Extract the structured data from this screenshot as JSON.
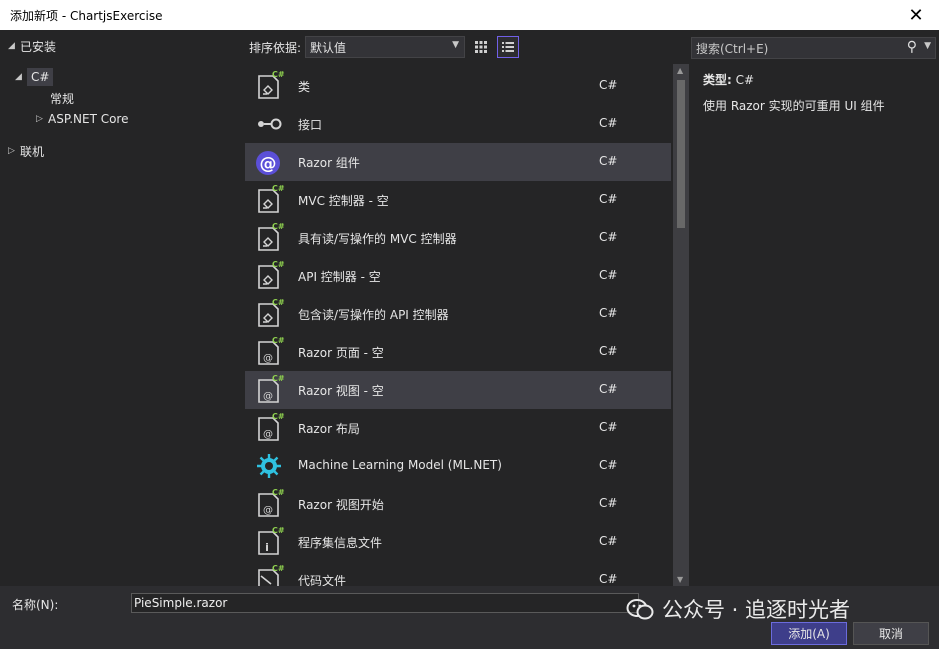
{
  "window": {
    "title": "添加新项 - ChartjsExercise",
    "close_glyph": "✕"
  },
  "tree": {
    "installed": "已安装",
    "csharp": "C#",
    "general": "常规",
    "aspnet": "ASP.NET Core",
    "online": "联机"
  },
  "toolbar": {
    "sort_label": "排序依据:",
    "sort_value": "默认值"
  },
  "search": {
    "placeholder": "搜索(Ctrl+E)"
  },
  "items": [
    {
      "name": "类",
      "lang": "C#",
      "icon": "class-file-icon"
    },
    {
      "name": "接口",
      "lang": "C#",
      "icon": "interface-icon"
    },
    {
      "name": "Razor 组件",
      "lang": "C#",
      "icon": "razor-component-icon"
    },
    {
      "name": "MVC 控制器 - 空",
      "lang": "C#",
      "icon": "controller-file-icon"
    },
    {
      "name": "具有读/写操作的 MVC 控制器",
      "lang": "C#",
      "icon": "controller-file-icon"
    },
    {
      "name": "API 控制器 - 空",
      "lang": "C#",
      "icon": "controller-file-icon"
    },
    {
      "name": "包含读/写操作的 API 控制器",
      "lang": "C#",
      "icon": "controller-file-icon"
    },
    {
      "name": "Razor 页面 - 空",
      "lang": "C#",
      "icon": "razor-page-icon"
    },
    {
      "name": "Razor 视图 - 空",
      "lang": "C#",
      "icon": "razor-page-icon"
    },
    {
      "name": "Razor 布局",
      "lang": "C#",
      "icon": "razor-page-icon"
    },
    {
      "name": "Machine Learning Model (ML.NET)",
      "lang": "C#",
      "icon": "ml-gear-icon"
    },
    {
      "name": "Razor 视图开始",
      "lang": "C#",
      "icon": "razor-page-icon"
    },
    {
      "name": "程序集信息文件",
      "lang": "C#",
      "icon": "info-file-icon"
    },
    {
      "name": "代码文件",
      "lang": "C#",
      "icon": "code-file-icon"
    }
  ],
  "detail": {
    "type_key": "类型:",
    "type_value": "C#",
    "description": "使用 Razor 实现的可重用 UI 组件"
  },
  "bottom": {
    "name_label": "名称(N):",
    "name_value": "PieSimple.razor",
    "add_label": "添加(A)",
    "cancel_label": "取消"
  },
  "watermark": {
    "text": "公众号 · 追逐时光者"
  },
  "colors": {
    "accent": "#7160e8",
    "csharp_green": "#8fd14f",
    "razor_purple": "#6c5ce7",
    "ml_cyan": "#2fc1e0"
  }
}
